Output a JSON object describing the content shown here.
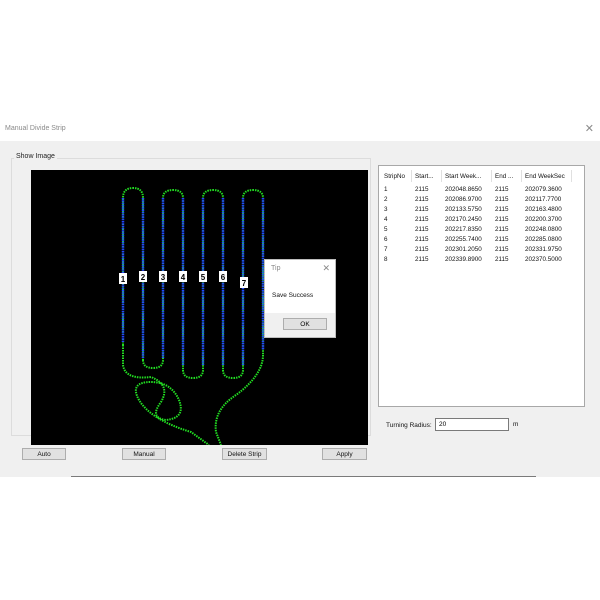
{
  "window": {
    "title": "Manual Divide Strip"
  },
  "show_image": {
    "label": "Show Image",
    "strip_labels": [
      "1",
      "2",
      "3",
      "4",
      "5",
      "6",
      "7"
    ]
  },
  "buttons": {
    "auto": "Auto",
    "manual": "Manual",
    "delete_strip": "Delete Strip",
    "apply": "Apply"
  },
  "table": {
    "columns": [
      "StripNo",
      "Start...",
      "Start Week...",
      "End ...",
      "End WeekSec"
    ],
    "rows": [
      [
        "1",
        "2115",
        "202048.8650",
        "2115",
        "202079.3600"
      ],
      [
        "2",
        "2115",
        "202086.9700",
        "2115",
        "202117.7700"
      ],
      [
        "3",
        "2115",
        "202133.5750",
        "2115",
        "202163.4800"
      ],
      [
        "4",
        "2115",
        "202170.2450",
        "2115",
        "202200.3700"
      ],
      [
        "5",
        "2115",
        "202217.8350",
        "2115",
        "202248.0800"
      ],
      [
        "6",
        "2115",
        "202255.7400",
        "2115",
        "202285.0800"
      ],
      [
        "7",
        "2115",
        "202301.2050",
        "2115",
        "202331.9750"
      ],
      [
        "8",
        "2115",
        "202339.8900",
        "2115",
        "202370.5000"
      ]
    ]
  },
  "turning_radius": {
    "label": "Turning Radius:",
    "value": "20",
    "unit": "m"
  },
  "dialog": {
    "title": "Tip",
    "message": "Save Success",
    "ok": "OK"
  },
  "colors": {
    "path_green": "#22dd22",
    "path_blue": "#2244ff",
    "canvas_bg": "#000000"
  }
}
